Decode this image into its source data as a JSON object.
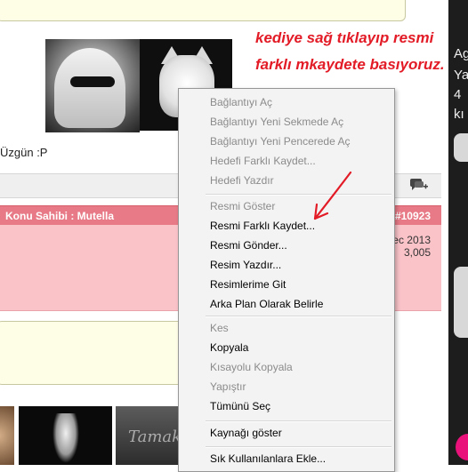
{
  "annotation": {
    "text": "kediye sağ tıklayıp resmi\nfarklı mkaydete basıyoruz."
  },
  "post": {
    "ozgun_label": "Üzgün :P",
    "author_label": "Konu Sahibi : Mutella",
    "post_number": "#10923",
    "date_fragment": "ec 2013",
    "post_count": "3,005"
  },
  "right_panel": {
    "line1": "Ag",
    "line2": "Ya",
    "line3": "4",
    "line4": "kı"
  },
  "thumbs": {
    "thumb3_text": "Tamak"
  },
  "context_menu": {
    "group1": [
      {
        "label": "Bağlantıyı Aç",
        "enabled": false
      },
      {
        "label": "Bağlantıyı Yeni Sekmede Aç",
        "enabled": false
      },
      {
        "label": "Bağlantıyı Yeni Pencerede Aç",
        "enabled": false
      },
      {
        "label": "Hedefi Farklı Kaydet...",
        "enabled": false
      },
      {
        "label": "Hedefi Yazdır",
        "enabled": false
      }
    ],
    "group2": [
      {
        "label": "Resmi Göster",
        "enabled": false
      },
      {
        "label": "Resmi Farklı Kaydet...",
        "enabled": true
      },
      {
        "label": "Resmi Gönder...",
        "enabled": true
      },
      {
        "label": "Resim Yazdır...",
        "enabled": true
      },
      {
        "label": "Resimlerime Git",
        "enabled": true
      },
      {
        "label": "Arka Plan Olarak Belirle",
        "enabled": true
      }
    ],
    "group3": [
      {
        "label": "Kes",
        "enabled": false
      },
      {
        "label": "Kopyala",
        "enabled": true
      },
      {
        "label": "Kısayolu Kopyala",
        "enabled": false
      },
      {
        "label": "Yapıştır",
        "enabled": false
      },
      {
        "label": "Tümünü Seç",
        "enabled": true
      }
    ],
    "group4": [
      {
        "label": "Kaynağı göster",
        "enabled": true
      }
    ],
    "group5": [
      {
        "label": "Sık Kullanılanlara Ekle...",
        "enabled": true
      }
    ]
  },
  "colors": {
    "annotation_red": "#e21b26",
    "post_header_pink": "#e77a86",
    "post_body_pink": "#f9c3c8",
    "menu_bg": "#f3f3f3"
  },
  "icons": {
    "quick_reply": "quick-reply-icon",
    "red_arrow": "red-arrow-icon"
  }
}
